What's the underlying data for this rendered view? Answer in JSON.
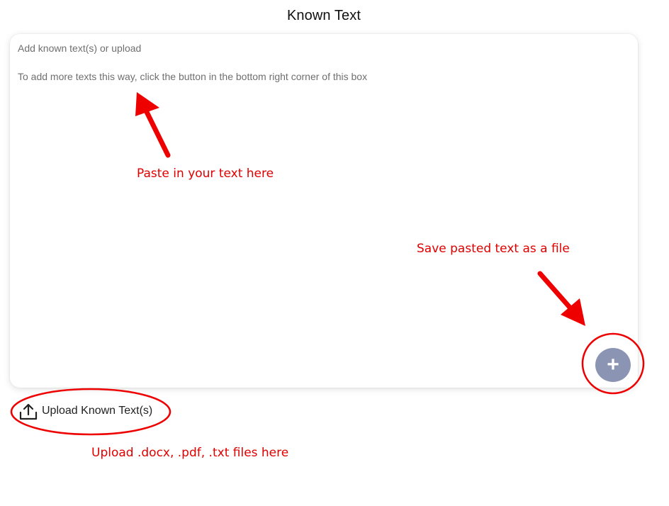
{
  "section": {
    "title": "Known Text"
  },
  "textbox": {
    "placeholder_line1": "Add known text(s) or upload",
    "placeholder_line2": "To add more texts this way, click the button in the bottom right corner of this box"
  },
  "add_button": {
    "label": "+",
    "color": "#8b95b3"
  },
  "upload": {
    "icon": "upload-icon",
    "label": "Upload Known Text(s)"
  },
  "annotations": {
    "color": "#e00000",
    "paste_hint": "Paste in your text here",
    "save_hint": "Save pasted text as a file",
    "upload_hint": "Upload .docx, .pdf, .txt files here"
  }
}
